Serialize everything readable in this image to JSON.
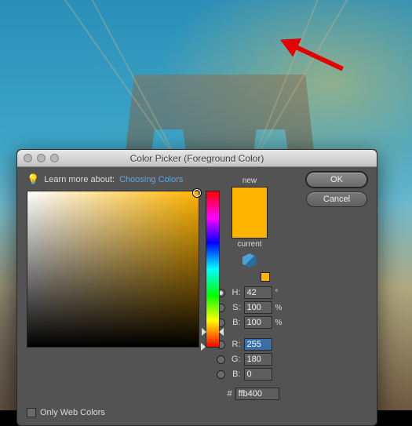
{
  "dialog": {
    "title": "Color Picker (Foreground Color)",
    "learn_label": "Learn more about:",
    "learn_link": "Choosing Colors"
  },
  "preview": {
    "new_label": "new",
    "current_label": "current",
    "new_color": "#ffb400",
    "current_color": "#ffb400"
  },
  "hsb": {
    "h_label": "H:",
    "h_value": "42",
    "h_unit": "°",
    "s_label": "S:",
    "s_value": "100",
    "s_unit": "%",
    "b_label": "B:",
    "b_value": "100",
    "b_unit": "%"
  },
  "rgb": {
    "r_label": "R:",
    "r_value": "255",
    "g_label": "G:",
    "g_value": "180",
    "b_label": "B:",
    "b_value": "0"
  },
  "hex": {
    "prefix": "#",
    "value": "ffb400"
  },
  "buttons": {
    "ok": "OK",
    "cancel": "Cancel"
  },
  "webcolors": {
    "label": "Only Web Colors",
    "checked": false
  }
}
